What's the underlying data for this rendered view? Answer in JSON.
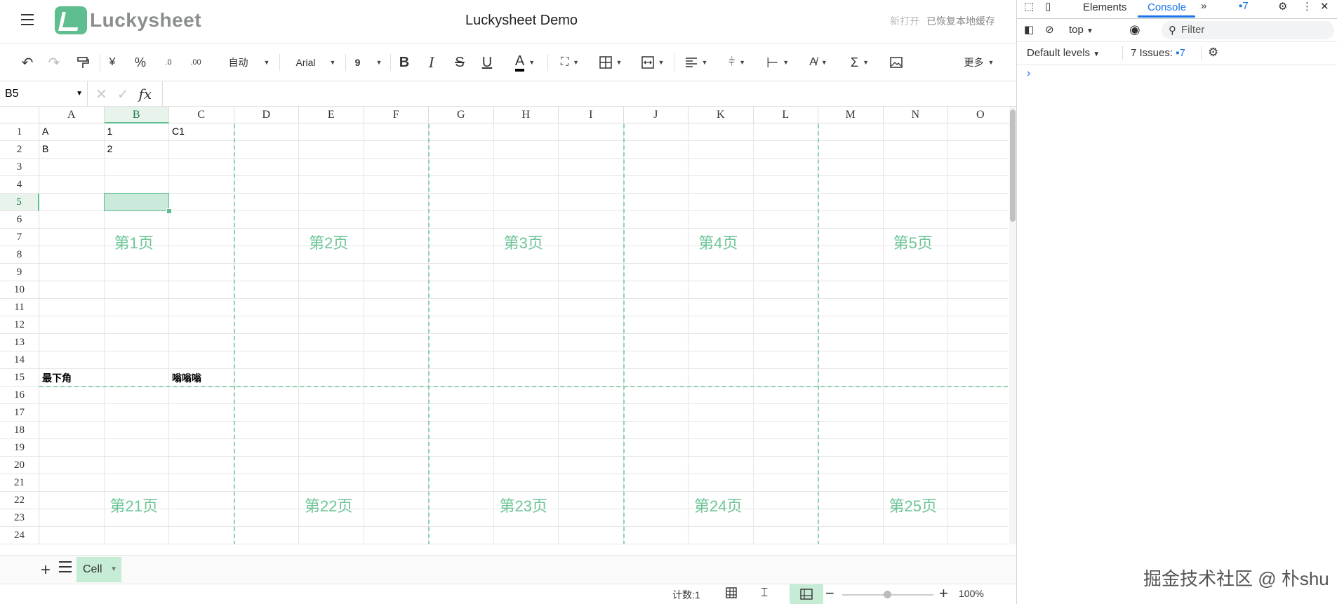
{
  "app": {
    "logo_text": "Luckysheet",
    "doc_title": "Luckysheet Demo",
    "status_new": "新打开",
    "status_saved": "已恢复本地缓存"
  },
  "toolbar": {
    "undo": "↶",
    "redo": "↷",
    "currency": "¥",
    "percent": "%",
    "decimal_dec": ".0",
    "decimal_inc": ".00",
    "format_label": "自动",
    "font_label": "Arial",
    "font_size": "9",
    "bold": "B",
    "italic": "I",
    "strike": "S",
    "underline": "U",
    "text_color": "A",
    "more_label": "更多"
  },
  "formula_bar": {
    "cell_ref": "B5",
    "fx_label": "fx"
  },
  "columns": [
    "A",
    "B",
    "C",
    "D",
    "E",
    "F",
    "G",
    "H",
    "I",
    "J",
    "K",
    "L",
    "M",
    "N",
    "O"
  ],
  "rows": [
    "1",
    "2",
    "3",
    "4",
    "5",
    "6",
    "7",
    "8",
    "9",
    "10",
    "11",
    "12",
    "13",
    "14",
    "15",
    "16",
    "17",
    "18",
    "19",
    "20",
    "21",
    "22",
    "23",
    "24"
  ],
  "selected": {
    "col": "B",
    "row": "5"
  },
  "cells": [
    {
      "col": "A",
      "row": "1",
      "value": "A"
    },
    {
      "col": "B",
      "row": "1",
      "value": "1"
    },
    {
      "col": "C",
      "row": "1",
      "value": "C1"
    },
    {
      "col": "A",
      "row": "2",
      "value": "B"
    },
    {
      "col": "B",
      "row": "2",
      "value": "2"
    },
    {
      "col": "A",
      "row": "15",
      "value": "最下角",
      "bold": true
    },
    {
      "col": "C",
      "row": "15",
      "value": "嗡嗡嗡",
      "bold": true
    }
  ],
  "page_labels": [
    "第1页",
    "第2页",
    "第3页",
    "第4页",
    "第5页",
    "第21页",
    "第22页",
    "第23页",
    "第24页",
    "第25页"
  ],
  "sheet_tabs": [
    {
      "label": "Cell",
      "active": true
    }
  ],
  "statusbar": {
    "count": "计数:1",
    "zoom": "100%",
    "zoom_level": 0.5
  },
  "devtools": {
    "tabs": [
      "Elements",
      "Console"
    ],
    "active_tab": "Console",
    "issues_badge": "7",
    "context": "top",
    "filter_placeholder": "Filter",
    "levels": "Default levels",
    "issues_label": "7 Issues:",
    "issues_count": "7",
    "prompt": "›"
  },
  "watermark": "掘金技术社区 @ 朴shu",
  "colors": {
    "accent": "#5fbe8f",
    "page_label": "#6cc596",
    "sheet_tab_bg": "#c6ecd6",
    "devtools_blue": "#1a73e8"
  }
}
